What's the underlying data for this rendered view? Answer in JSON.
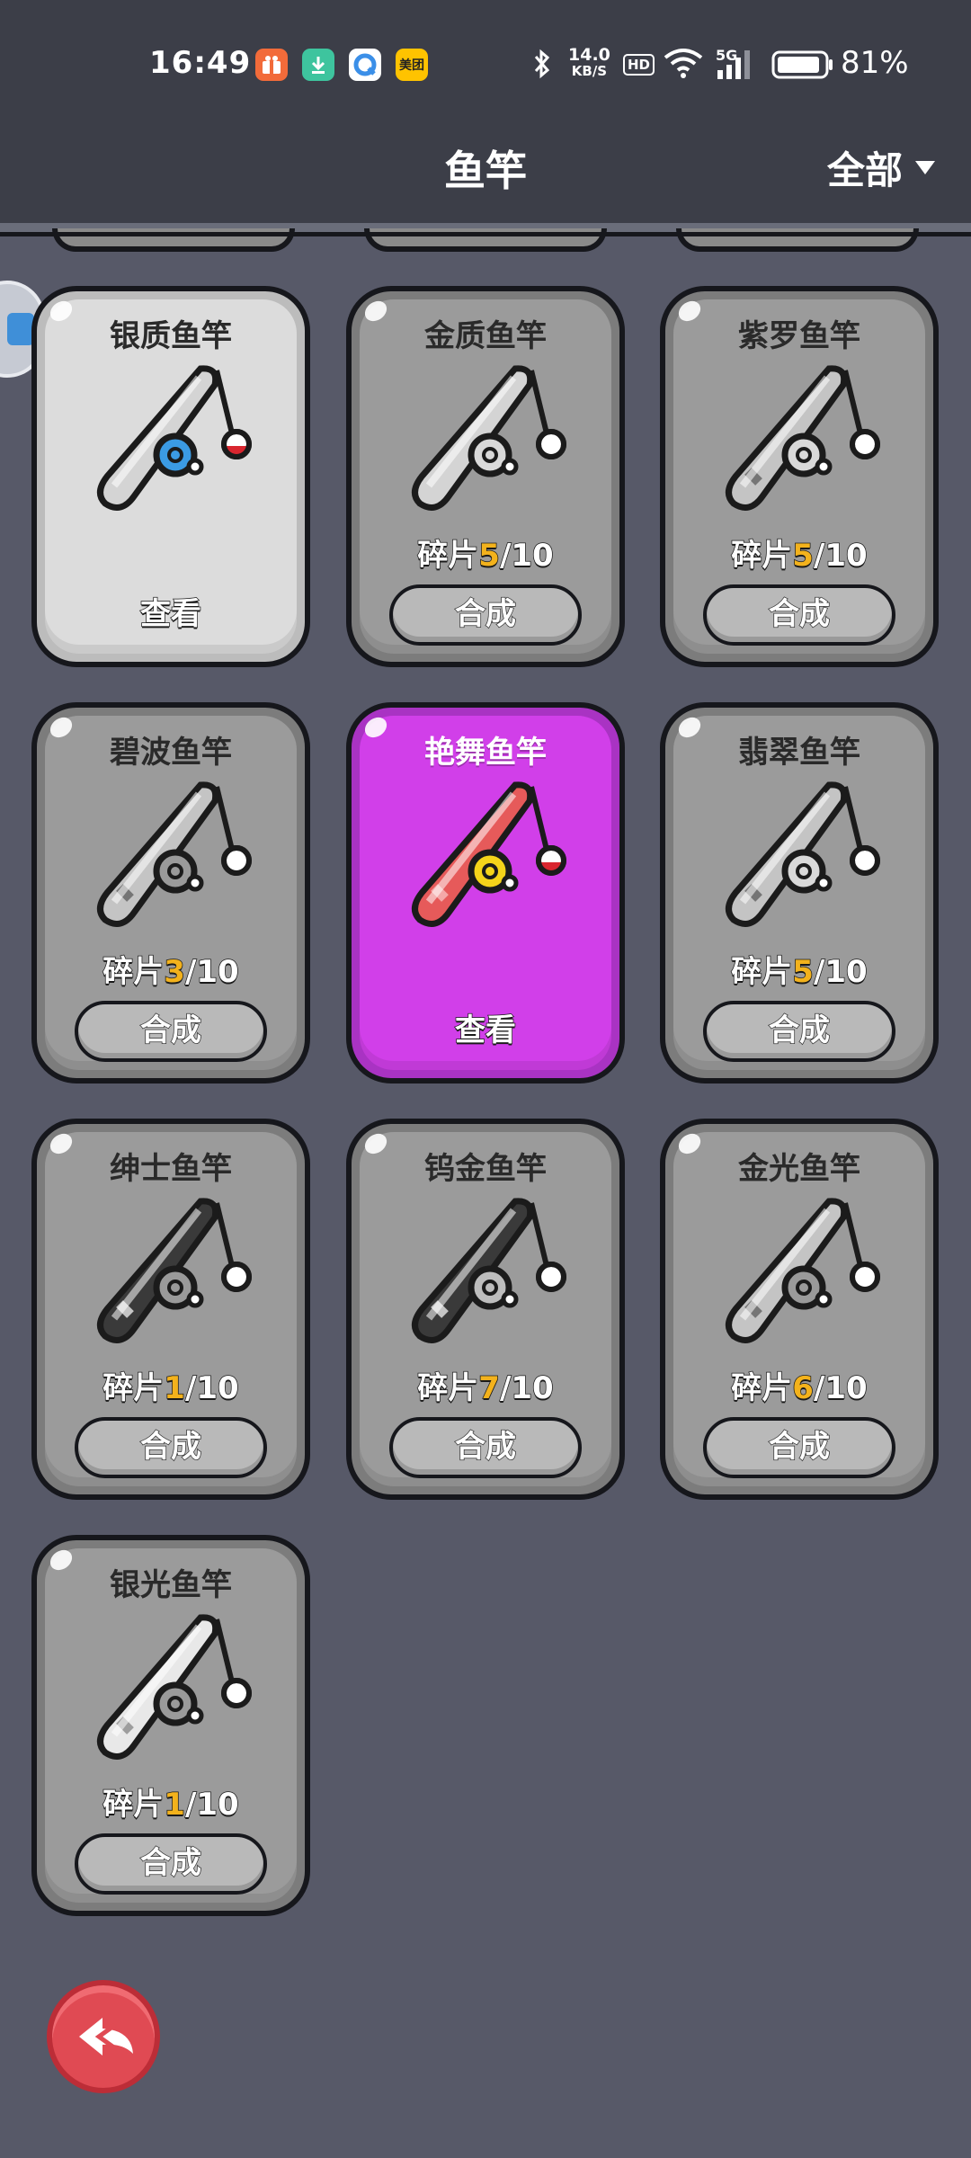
{
  "status_bar": {
    "time": "16:49",
    "apps": [
      {
        "icon": "gift-app-icon",
        "color": "#f26b3a"
      },
      {
        "icon": "download-app-icon",
        "color": "#3ec49e"
      },
      {
        "icon": "browser-app-icon",
        "color": "#3b8fe8"
      },
      {
        "icon": "meituan-app-icon",
        "color": "#ffc300",
        "label": "美团"
      }
    ],
    "net_speed": "14.0",
    "net_unit": "KB/S",
    "hd": "HD",
    "signal_label": "5G",
    "battery": "81%"
  },
  "header": {
    "title": "鱼竿",
    "filter_label": "全部"
  },
  "rods": [
    {
      "name": "银质鱼竿",
      "state": "owned",
      "action": "查看",
      "pattern": "plain",
      "reel": "#3b9be4",
      "bobber": "#d9262f"
    },
    {
      "name": "金质鱼竿",
      "state": "locked",
      "have": "5",
      "need": "10",
      "action": "合成",
      "pattern": "plain",
      "reel": "#d9d9d9",
      "bobber": "#ffffff"
    },
    {
      "name": "紫罗鱼竿",
      "state": "locked",
      "have": "5",
      "need": "10",
      "action": "合成",
      "pattern": "stripe",
      "reel": "#d9d9d9",
      "bobber": "#ffffff"
    },
    {
      "name": "碧波鱼竿",
      "state": "locked",
      "have": "3",
      "need": "10",
      "action": "合成",
      "pattern": "stripe",
      "reel": "#9a9a9a",
      "bobber": "#ffffff"
    },
    {
      "name": "艳舞鱼竿",
      "state": "highlight",
      "action": "查看",
      "pattern": "stripe-red",
      "reel": "#f4d41a",
      "bobber": "#d9262f"
    },
    {
      "name": "翡翠鱼竿",
      "state": "locked",
      "have": "5",
      "need": "10",
      "action": "合成",
      "pattern": "stripe",
      "reel": "#d9d9d9",
      "bobber": "#ffffff"
    },
    {
      "name": "绅士鱼竿",
      "state": "locked",
      "have": "1",
      "need": "10",
      "action": "合成",
      "pattern": "dark-stripe",
      "reel": "#9a9a9a",
      "bobber": "#ffffff"
    },
    {
      "name": "钨金鱼竿",
      "state": "locked",
      "have": "7",
      "need": "10",
      "action": "合成",
      "pattern": "dark-stripe",
      "reel": "#bdbdbd",
      "bobber": "#ffffff"
    },
    {
      "name": "金光鱼竿",
      "state": "locked",
      "have": "6",
      "need": "10",
      "action": "合成",
      "pattern": "stripe",
      "reel": "#9a9a9a",
      "bobber": "#ffffff"
    },
    {
      "name": "银光鱼竿",
      "state": "locked",
      "have": "1",
      "need": "10",
      "action": "合成",
      "pattern": "light-stripe",
      "reel": "#9a9a9a",
      "bobber": "#ffffff"
    }
  ],
  "fragment_prefix": "碎片",
  "fragment_sep": "/",
  "back_button_icon": "back-arrow-icon"
}
